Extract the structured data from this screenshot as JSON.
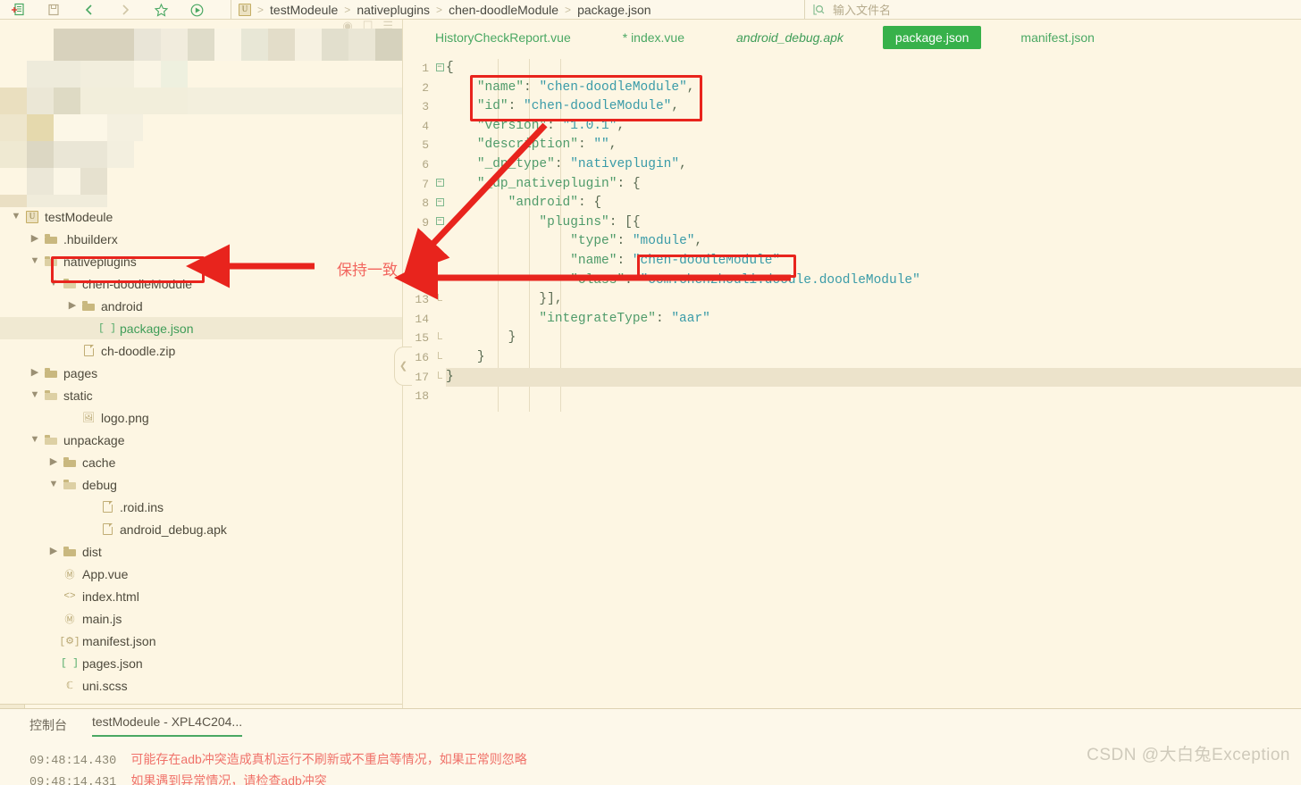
{
  "app": {
    "accent_green": "#37b14a",
    "bg": "#fdf6e3",
    "annotation_red": "#e8241d"
  },
  "toolbar": {
    "icons": [
      {
        "name": "new-file-icon",
        "glyph": "new"
      },
      {
        "name": "save-icon",
        "glyph": "save"
      },
      {
        "name": "back-icon",
        "glyph": "back"
      },
      {
        "name": "forward-icon",
        "glyph": "forward"
      },
      {
        "name": "favorite-star-icon",
        "glyph": "star"
      },
      {
        "name": "run-icon",
        "glyph": "run"
      }
    ],
    "breadcrumb": [
      "testModeule",
      "nativeplugins",
      "chen-doodleModule",
      "package.json"
    ],
    "project_badge": "U",
    "search_placeholder": "输入文件名",
    "panel_icons": [
      "target-icon",
      "collapse-icon",
      "menu-icon"
    ]
  },
  "tree": {
    "items": [
      {
        "indent": 0,
        "caret": "v",
        "icon": "project",
        "label": "testModeule",
        "selected": false,
        "green": false
      },
      {
        "indent": 1,
        "caret": ">",
        "icon": "folder",
        "label": ".hbuilderx",
        "selected": false,
        "green": false
      },
      {
        "indent": 1,
        "caret": "v",
        "icon": "folderopen",
        "label": "nativeplugins",
        "selected": false,
        "green": false
      },
      {
        "indent": 2,
        "caret": "v",
        "icon": "folderopen",
        "label": "chen-doodleModule",
        "selected": false,
        "green": false
      },
      {
        "indent": 3,
        "caret": ">",
        "icon": "folder",
        "label": "android",
        "selected": false,
        "green": false
      },
      {
        "indent": 4,
        "caret": "",
        "icon": "json",
        "label": "package.json",
        "selected": true,
        "green": true
      },
      {
        "indent": 3,
        "caret": "",
        "icon": "doc",
        "label": "ch-doodle.zip",
        "selected": false,
        "green": false
      },
      {
        "indent": 1,
        "caret": ">",
        "icon": "folder",
        "label": "pages",
        "selected": false,
        "green": false
      },
      {
        "indent": 1,
        "caret": "v",
        "icon": "folderopen",
        "label": "static",
        "selected": false,
        "green": false
      },
      {
        "indent": 3,
        "caret": "",
        "icon": "image",
        "label": "logo.png",
        "selected": false,
        "green": false
      },
      {
        "indent": 1,
        "caret": "v",
        "icon": "folderopen",
        "label": "unpackage",
        "selected": false,
        "green": false
      },
      {
        "indent": 2,
        "caret": ">",
        "icon": "folder",
        "label": "cache",
        "selected": false,
        "green": false
      },
      {
        "indent": 2,
        "caret": "v",
        "icon": "folderopen",
        "label": "debug",
        "selected": false,
        "green": false
      },
      {
        "indent": 4,
        "caret": "",
        "icon": "doc",
        "label": ".roid.ins",
        "selected": false,
        "green": false
      },
      {
        "indent": 4,
        "caret": "",
        "icon": "doc",
        "label": "android_debug.apk",
        "selected": false,
        "green": false
      },
      {
        "indent": 2,
        "caret": ">",
        "icon": "folder",
        "label": "dist",
        "selected": false,
        "green": false
      },
      {
        "indent": 2,
        "caret": "",
        "icon": "vue",
        "label": "App.vue",
        "selected": false,
        "green": false
      },
      {
        "indent": 2,
        "caret": "",
        "icon": "html",
        "label": "index.html",
        "selected": false,
        "green": false
      },
      {
        "indent": 2,
        "caret": "",
        "icon": "js",
        "label": "main.js",
        "selected": false,
        "green": false
      },
      {
        "indent": 2,
        "caret": "",
        "icon": "manifest",
        "label": "manifest.json",
        "selected": false,
        "green": false
      },
      {
        "indent": 2,
        "caret": "",
        "icon": "json",
        "label": "pages.json",
        "selected": false,
        "green": false
      },
      {
        "indent": 2,
        "caret": "",
        "icon": "scss",
        "label": "uni.scss",
        "selected": false,
        "green": false
      }
    ],
    "strip_icons": [
      "files-icon",
      "debug-icon",
      "search-icon",
      "plugins-icon"
    ]
  },
  "editor": {
    "tabs": [
      {
        "label": "HistoryCheckReport.vue",
        "active": false,
        "dirty": false,
        "italic": false
      },
      {
        "label": "* index.vue",
        "active": false,
        "dirty": true,
        "italic": false
      },
      {
        "label": "android_debug.apk",
        "active": false,
        "dirty": false,
        "italic": true
      },
      {
        "label": "package.json",
        "active": true,
        "dirty": false,
        "italic": false
      },
      {
        "label": "manifest.json",
        "active": false,
        "dirty": false,
        "italic": false
      }
    ],
    "lines": [
      {
        "n": 1,
        "fold": "minus",
        "text": "{",
        "hl": false
      },
      {
        "n": 2,
        "fold": "",
        "text": "    \"name\": \"chen-doodleModule\",",
        "hl": false
      },
      {
        "n": 3,
        "fold": "",
        "text": "    \"id\": \"chen-doodleModule\",",
        "hl": false
      },
      {
        "n": 4,
        "fold": "",
        "text": "    \"version\": \"1.0.1\",",
        "hl": false
      },
      {
        "n": 5,
        "fold": "",
        "text": "    \"description\": \"\",",
        "hl": false
      },
      {
        "n": 6,
        "fold": "",
        "text": "    \"_dp_type\": \"nativeplugin\",",
        "hl": false
      },
      {
        "n": 7,
        "fold": "minus",
        "text": "    \"_dp_nativeplugin\": {",
        "hl": false
      },
      {
        "n": 8,
        "fold": "minus",
        "text": "        \"android\": {",
        "hl": false
      },
      {
        "n": 9,
        "fold": "minus",
        "text": "            \"plugins\": [{",
        "hl": false
      },
      {
        "n": 10,
        "fold": "",
        "text": "                \"type\": \"module\",",
        "hl": false
      },
      {
        "n": 11,
        "fold": "",
        "text": "                \"name\": \"chen-doodleModule\"",
        "hl": false
      },
      {
        "n": 12,
        "fold": "",
        "text": "                \"class\": \"com.chenzhouli.doodle.doodleModule\"",
        "hl": false
      },
      {
        "n": 13,
        "fold": "end",
        "text": "            }],",
        "hl": false
      },
      {
        "n": 14,
        "fold": "",
        "text": "            \"integrateType\": \"aar\"",
        "hl": false
      },
      {
        "n": 15,
        "fold": "end",
        "text": "        }",
        "hl": false
      },
      {
        "n": 16,
        "fold": "end",
        "text": "    }",
        "hl": false
      },
      {
        "n": 17,
        "fold": "end",
        "text": "}",
        "hl": true
      },
      {
        "n": 18,
        "fold": "",
        "text": "",
        "hl": false
      }
    ]
  },
  "annotations": {
    "note_text": "保持一致",
    "boxes": [
      {
        "name": "json-name-id-highlight"
      },
      {
        "name": "tree-module-highlight"
      },
      {
        "name": "plugin-name-highlight"
      }
    ]
  },
  "console": {
    "label": "控制台",
    "active_item": "testModeule - XPL4C204...",
    "logs": [
      {
        "ts": "09:48:14.430",
        "msg": "可能存在adb冲突造成真机运行不刷新或不重启等情况，如果正常则忽略"
      },
      {
        "ts": "09:48:14.431",
        "msg": "如果遇到异常情况，请检查adb冲突"
      }
    ]
  },
  "watermark": "CSDN @大白兔Exception"
}
